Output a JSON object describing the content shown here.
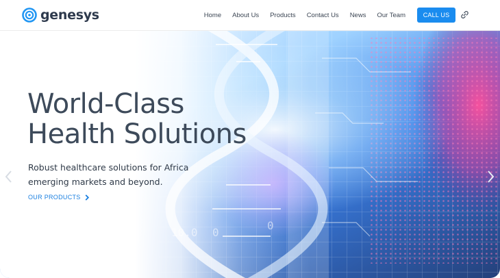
{
  "header": {
    "logo": {
      "text": "genesys",
      "icon": "genesys-logo-icon",
      "color": "#2196f3"
    },
    "nav": [
      {
        "label": "Home"
      },
      {
        "label": "About Us"
      },
      {
        "label": "Products"
      },
      {
        "label": "Contact Us"
      },
      {
        "label": "News"
      },
      {
        "label": "Our Team"
      }
    ],
    "call_button": "CALL US",
    "link_icon": "link-icon"
  },
  "hero": {
    "title_line1": "World-Class",
    "title_line2": "Health Solutions",
    "subtitle": "Robust healthcare solutions for Africa emerging markets and beyond.",
    "cta": "OUR PRODUCTS",
    "background": "dna-technology-image",
    "prev_icon": "chevron-left-icon",
    "next_icon": "chevron-right-icon"
  },
  "colors": {
    "accent": "#1a8cef",
    "title": "#3d4a5a",
    "text": "#2f3a48",
    "bg_pink": "#ff4f9a",
    "bg_blue": "#3b8cff"
  }
}
